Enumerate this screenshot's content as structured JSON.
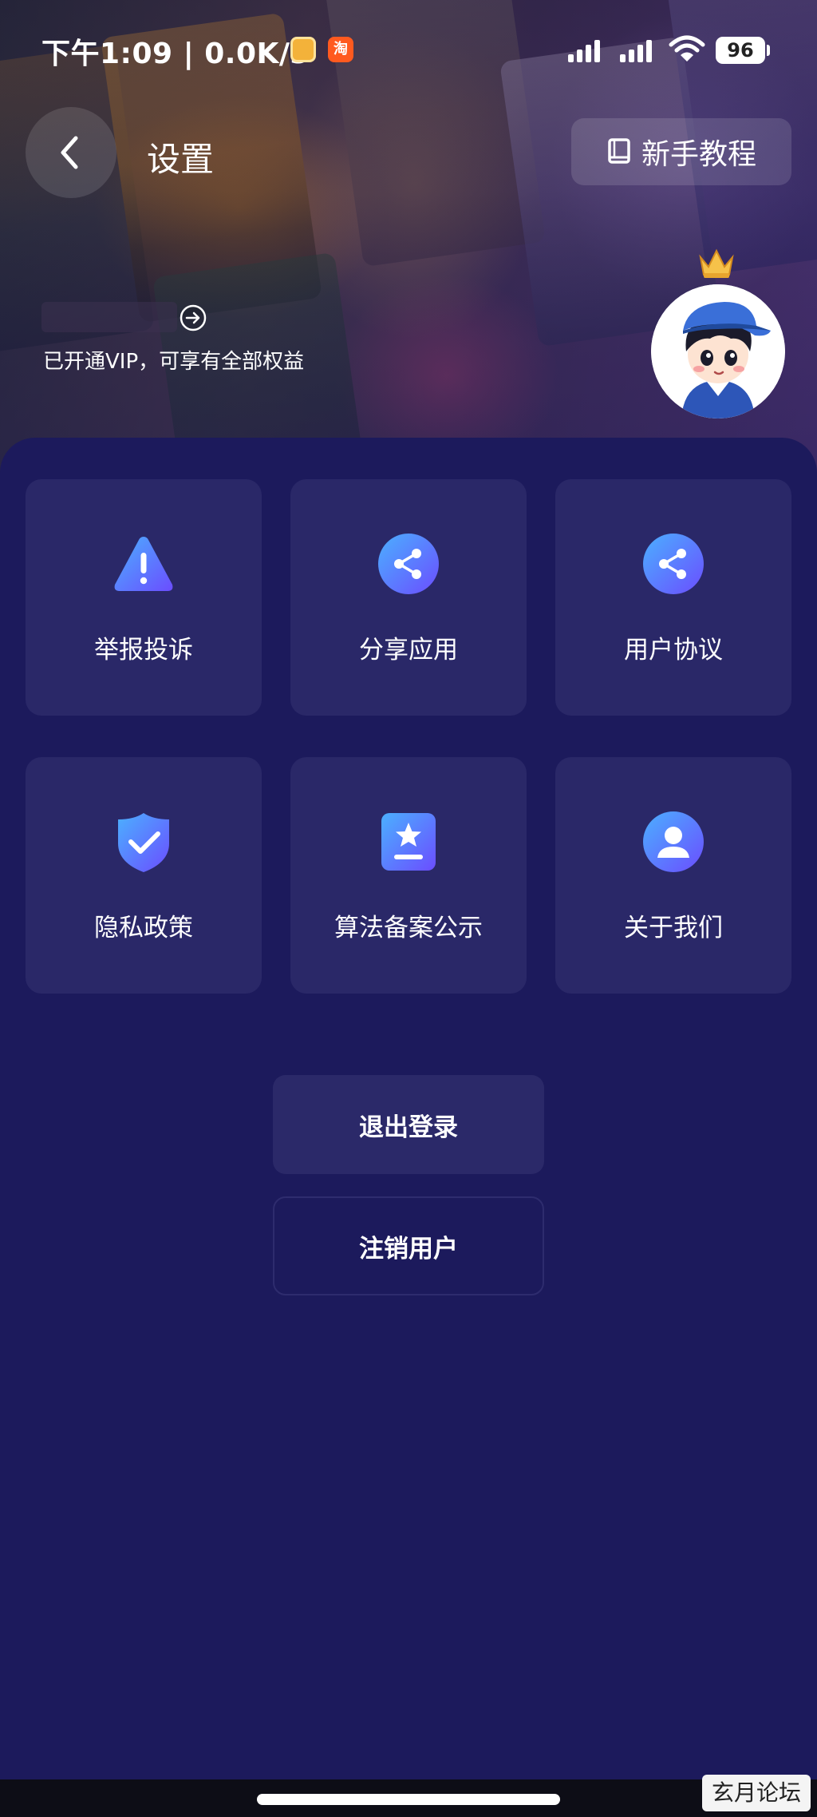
{
  "status_bar": {
    "time_network": "下午1:09 | 0.0K/s",
    "taobao_icon_text": "淘",
    "battery": "96"
  },
  "header": {
    "title": "设置",
    "back_icon": "chevron-left-icon",
    "tutorial_label": "新手教程",
    "tutorial_icon": "book-icon"
  },
  "user": {
    "vip_text": "已开通VIP，可享有全部权益",
    "arrow_icon": "arrow-right-circle-icon",
    "crown_icon": "crown-icon"
  },
  "menu": {
    "items": [
      {
        "label": "举报投诉",
        "icon": "warning-icon"
      },
      {
        "label": "分享应用",
        "icon": "share-icon"
      },
      {
        "label": "用户协议",
        "icon": "share-icon"
      },
      {
        "label": "隐私政策",
        "icon": "shield-check-icon"
      },
      {
        "label": "算法备案公示",
        "icon": "star-badge-icon"
      },
      {
        "label": "关于我们",
        "icon": "user-icon"
      }
    ]
  },
  "actions": {
    "logout_label": "退出登录",
    "deregister_label": "注销用户"
  },
  "watermark": "玄月论坛",
  "colors": {
    "background": "#1c1a5c",
    "card": "#2a2868",
    "icon_gradient_start": "#4bb0ff",
    "icon_gradient_end": "#6b4dff"
  }
}
